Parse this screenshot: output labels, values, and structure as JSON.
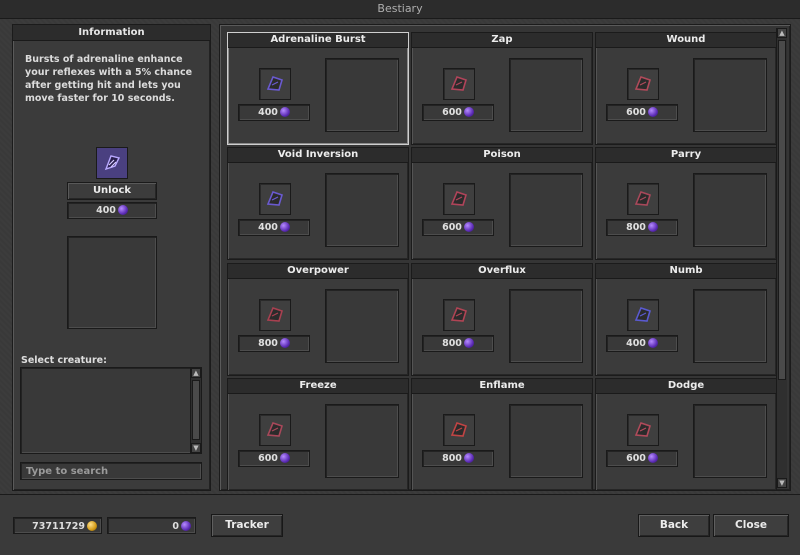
{
  "window": {
    "title": "Bestiary"
  },
  "info": {
    "header": "Information",
    "description": "Bursts of adrenaline enhance your reflexes with a 5% chance after getting hit and lets you move faster for 10 seconds.",
    "unlock_label": "Unlock",
    "cost": "400",
    "icon": "adrenaline-rune-icon",
    "select_creature_label": "Select creature:",
    "search_placeholder": "Type to search"
  },
  "cards": [
    {
      "name": "Adrenaline Burst",
      "cost": "400",
      "icon": "adrenaline-burst-icon",
      "color": "#6a5ad0",
      "selected": true
    },
    {
      "name": "Zap",
      "cost": "600",
      "icon": "zap-icon",
      "color": "#b0445a"
    },
    {
      "name": "Wound",
      "cost": "600",
      "icon": "wound-icon",
      "color": "#b04a5a"
    },
    {
      "name": "Void Inversion",
      "cost": "400",
      "icon": "void-inversion-icon",
      "color": "#6a5ad0"
    },
    {
      "name": "Poison",
      "cost": "600",
      "icon": "poison-icon",
      "color": "#b0445a"
    },
    {
      "name": "Parry",
      "cost": "800",
      "icon": "parry-icon",
      "color": "#a8485a"
    },
    {
      "name": "Overpower",
      "cost": "800",
      "icon": "overpower-icon",
      "color": "#a84050"
    },
    {
      "name": "Overflux",
      "cost": "800",
      "icon": "overflux-icon",
      "color": "#b04454"
    },
    {
      "name": "Numb",
      "cost": "400",
      "icon": "numb-icon",
      "color": "#5a5ad0"
    },
    {
      "name": "Freeze",
      "cost": "600",
      "icon": "freeze-icon",
      "color": "#a8485a"
    },
    {
      "name": "Enflame",
      "cost": "800",
      "icon": "enflame-icon",
      "color": "#c04444"
    },
    {
      "name": "Dodge",
      "cost": "600",
      "icon": "dodge-icon",
      "color": "#b04a5a"
    }
  ],
  "footer": {
    "gold": "73711729",
    "gems": "0",
    "tracker_label": "Tracker",
    "back_label": "Back",
    "close_label": "Close"
  }
}
